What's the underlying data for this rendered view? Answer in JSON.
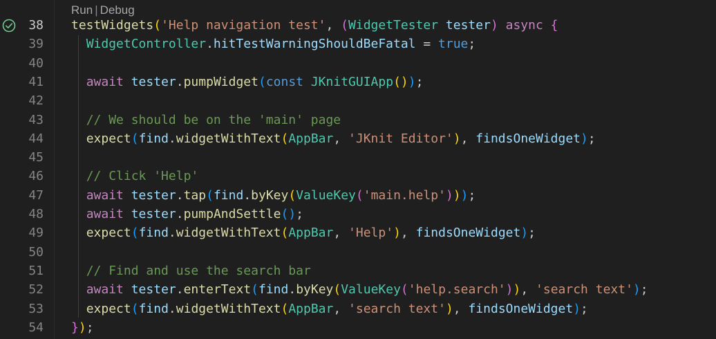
{
  "codelens": {
    "run": "Run",
    "separator": "|",
    "debug": "Debug"
  },
  "lines": [
    {
      "num": "38",
      "status": "passed",
      "tokens": [
        {
          "t": "testWidgets",
          "c": "fn"
        },
        {
          "t": "(",
          "c": "b1"
        },
        {
          "t": "'Help navigation test'",
          "c": "str"
        },
        {
          "t": ", ",
          "c": "pn"
        },
        {
          "t": "(",
          "c": "b2"
        },
        {
          "t": "WidgetTester",
          "c": "type"
        },
        {
          "t": " ",
          "c": "pn"
        },
        {
          "t": "tester",
          "c": "var"
        },
        {
          "t": ")",
          "c": "b2"
        },
        {
          "t": " ",
          "c": "pn"
        },
        {
          "t": "async",
          "c": "ctl"
        },
        {
          "t": " ",
          "c": "pn"
        },
        {
          "t": "{",
          "c": "b2"
        }
      ]
    },
    {
      "num": "39",
      "tokens": [
        {
          "t": "  ",
          "c": "pn"
        },
        {
          "t": "WidgetController",
          "c": "type"
        },
        {
          "t": ".",
          "c": "pn"
        },
        {
          "t": "hitTestWarningShouldBeFatal",
          "c": "var"
        },
        {
          "t": " = ",
          "c": "pn"
        },
        {
          "t": "true",
          "c": "kw"
        },
        {
          "t": ";",
          "c": "pn"
        }
      ]
    },
    {
      "num": "40",
      "tokens": []
    },
    {
      "num": "41",
      "tokens": [
        {
          "t": "  ",
          "c": "pn"
        },
        {
          "t": "await",
          "c": "ctl"
        },
        {
          "t": " ",
          "c": "pn"
        },
        {
          "t": "tester",
          "c": "var"
        },
        {
          "t": ".",
          "c": "pn"
        },
        {
          "t": "pumpWidget",
          "c": "fn"
        },
        {
          "t": "(",
          "c": "b3"
        },
        {
          "t": "const",
          "c": "kw"
        },
        {
          "t": " ",
          "c": "pn"
        },
        {
          "t": "JKnitGUIApp",
          "c": "type"
        },
        {
          "t": "(",
          "c": "b1"
        },
        {
          "t": ")",
          "c": "b1"
        },
        {
          "t": ")",
          "c": "b3"
        },
        {
          "t": ";",
          "c": "pn"
        }
      ]
    },
    {
      "num": "42",
      "tokens": []
    },
    {
      "num": "43",
      "tokens": [
        {
          "t": "  ",
          "c": "pn"
        },
        {
          "t": "// We should be on the 'main' page",
          "c": "cmt"
        }
      ]
    },
    {
      "num": "44",
      "tokens": [
        {
          "t": "  ",
          "c": "pn"
        },
        {
          "t": "expect",
          "c": "fn"
        },
        {
          "t": "(",
          "c": "b3"
        },
        {
          "t": "find",
          "c": "var"
        },
        {
          "t": ".",
          "c": "pn"
        },
        {
          "t": "widgetWithText",
          "c": "fn"
        },
        {
          "t": "(",
          "c": "b1"
        },
        {
          "t": "AppBar",
          "c": "type"
        },
        {
          "t": ", ",
          "c": "pn"
        },
        {
          "t": "'JKnit Editor'",
          "c": "str"
        },
        {
          "t": ")",
          "c": "b1"
        },
        {
          "t": ", ",
          "c": "pn"
        },
        {
          "t": "findsOneWidget",
          "c": "var"
        },
        {
          "t": ")",
          "c": "b3"
        },
        {
          "t": ";",
          "c": "pn"
        }
      ]
    },
    {
      "num": "45",
      "tokens": []
    },
    {
      "num": "46",
      "tokens": [
        {
          "t": "  ",
          "c": "pn"
        },
        {
          "t": "// Click 'Help'",
          "c": "cmt"
        }
      ]
    },
    {
      "num": "47",
      "tokens": [
        {
          "t": "  ",
          "c": "pn"
        },
        {
          "t": "await",
          "c": "ctl"
        },
        {
          "t": " ",
          "c": "pn"
        },
        {
          "t": "tester",
          "c": "var"
        },
        {
          "t": ".",
          "c": "pn"
        },
        {
          "t": "tap",
          "c": "fn"
        },
        {
          "t": "(",
          "c": "b3"
        },
        {
          "t": "find",
          "c": "var"
        },
        {
          "t": ".",
          "c": "pn"
        },
        {
          "t": "byKey",
          "c": "fn"
        },
        {
          "t": "(",
          "c": "b1"
        },
        {
          "t": "ValueKey",
          "c": "type"
        },
        {
          "t": "(",
          "c": "b2"
        },
        {
          "t": "'main.help'",
          "c": "str"
        },
        {
          "t": ")",
          "c": "b2"
        },
        {
          "t": ")",
          "c": "b1"
        },
        {
          "t": ")",
          "c": "b3"
        },
        {
          "t": ";",
          "c": "pn"
        }
      ]
    },
    {
      "num": "48",
      "tokens": [
        {
          "t": "  ",
          "c": "pn"
        },
        {
          "t": "await",
          "c": "ctl"
        },
        {
          "t": " ",
          "c": "pn"
        },
        {
          "t": "tester",
          "c": "var"
        },
        {
          "t": ".",
          "c": "pn"
        },
        {
          "t": "pumpAndSettle",
          "c": "fn"
        },
        {
          "t": "(",
          "c": "b3"
        },
        {
          "t": ")",
          "c": "b3"
        },
        {
          "t": ";",
          "c": "pn"
        }
      ]
    },
    {
      "num": "49",
      "tokens": [
        {
          "t": "  ",
          "c": "pn"
        },
        {
          "t": "expect",
          "c": "fn"
        },
        {
          "t": "(",
          "c": "b3"
        },
        {
          "t": "find",
          "c": "var"
        },
        {
          "t": ".",
          "c": "pn"
        },
        {
          "t": "widgetWithText",
          "c": "fn"
        },
        {
          "t": "(",
          "c": "b1"
        },
        {
          "t": "AppBar",
          "c": "type"
        },
        {
          "t": ", ",
          "c": "pn"
        },
        {
          "t": "'Help'",
          "c": "str"
        },
        {
          "t": ")",
          "c": "b1"
        },
        {
          "t": ", ",
          "c": "pn"
        },
        {
          "t": "findsOneWidget",
          "c": "var"
        },
        {
          "t": ")",
          "c": "b3"
        },
        {
          "t": ";",
          "c": "pn"
        }
      ]
    },
    {
      "num": "50",
      "tokens": []
    },
    {
      "num": "51",
      "tokens": [
        {
          "t": "  ",
          "c": "pn"
        },
        {
          "t": "// Find and use the search bar",
          "c": "cmt"
        }
      ]
    },
    {
      "num": "52",
      "tokens": [
        {
          "t": "  ",
          "c": "pn"
        },
        {
          "t": "await",
          "c": "ctl"
        },
        {
          "t": " ",
          "c": "pn"
        },
        {
          "t": "tester",
          "c": "var"
        },
        {
          "t": ".",
          "c": "pn"
        },
        {
          "t": "enterText",
          "c": "fn"
        },
        {
          "t": "(",
          "c": "b3"
        },
        {
          "t": "find",
          "c": "var"
        },
        {
          "t": ".",
          "c": "pn"
        },
        {
          "t": "byKey",
          "c": "fn"
        },
        {
          "t": "(",
          "c": "b1"
        },
        {
          "t": "ValueKey",
          "c": "type"
        },
        {
          "t": "(",
          "c": "b2"
        },
        {
          "t": "'help.search'",
          "c": "str"
        },
        {
          "t": ")",
          "c": "b2"
        },
        {
          "t": ")",
          "c": "b1"
        },
        {
          "t": ", ",
          "c": "pn"
        },
        {
          "t": "'search text'",
          "c": "str"
        },
        {
          "t": ")",
          "c": "b3"
        },
        {
          "t": ";",
          "c": "pn"
        }
      ]
    },
    {
      "num": "53",
      "tokens": [
        {
          "t": "  ",
          "c": "pn"
        },
        {
          "t": "expect",
          "c": "fn"
        },
        {
          "t": "(",
          "c": "b3"
        },
        {
          "t": "find",
          "c": "var"
        },
        {
          "t": ".",
          "c": "pn"
        },
        {
          "t": "widgetWithText",
          "c": "fn"
        },
        {
          "t": "(",
          "c": "b1"
        },
        {
          "t": "AppBar",
          "c": "type"
        },
        {
          "t": ", ",
          "c": "pn"
        },
        {
          "t": "'search text'",
          "c": "str"
        },
        {
          "t": ")",
          "c": "b1"
        },
        {
          "t": ", ",
          "c": "pn"
        },
        {
          "t": "findsOneWidget",
          "c": "var"
        },
        {
          "t": ")",
          "c": "b3"
        },
        {
          "t": ";",
          "c": "pn"
        }
      ]
    },
    {
      "num": "54",
      "tokens": [
        {
          "t": "}",
          "c": "b2"
        },
        {
          "t": ")",
          "c": "b1"
        },
        {
          "t": ";",
          "c": "pn"
        }
      ]
    }
  ],
  "colors": {
    "background": "#1f1f1f",
    "line_number": "#858585",
    "test_passed": "#73c991",
    "function": "#dcdcaa",
    "string": "#ce9178",
    "keyword": "#569cd6",
    "control": "#c586c0",
    "type": "#4ec9b0",
    "variable": "#9cdcfe",
    "comment": "#6a9955"
  }
}
